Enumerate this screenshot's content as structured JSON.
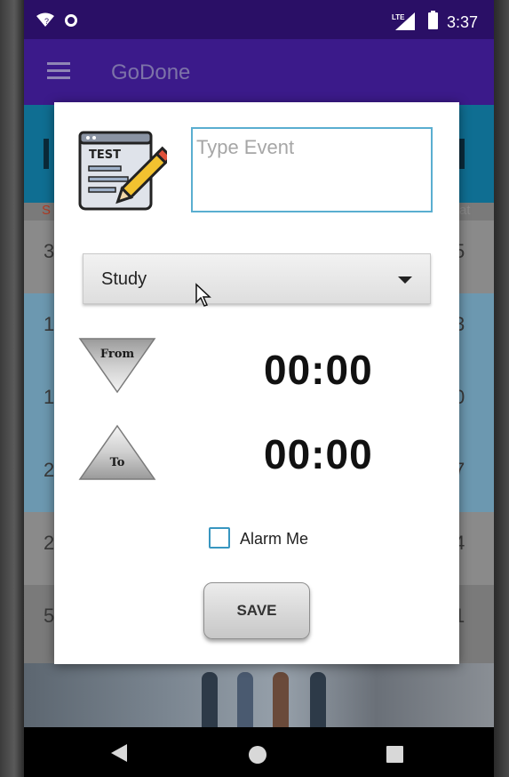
{
  "status_bar": {
    "time": "3:37",
    "network": "LTE"
  },
  "app_bar": {
    "title": "GoDone"
  },
  "calendar_background": {
    "weekday_left": "S",
    "weekday_right": "at",
    "rows": [
      {
        "left": "3",
        "right": "5"
      },
      {
        "left": "1",
        "right": "3"
      },
      {
        "left": "1",
        "right": "0"
      },
      {
        "left": "2",
        "right": "7"
      },
      {
        "left": "2",
        "right": "4"
      },
      {
        "left": "5",
        "right": "1"
      }
    ]
  },
  "dialog": {
    "icon_text": "TEST",
    "event_input": {
      "placeholder": "Type Event",
      "value": ""
    },
    "category": {
      "selected": "Study"
    },
    "from": {
      "label": "From",
      "time": "00:00"
    },
    "to": {
      "label": "To",
      "time": "00:00"
    },
    "alarm": {
      "label": "Alarm Me",
      "checked": false
    },
    "save_label": "SAVE"
  },
  "colors": {
    "status_bar": "#2a0f66",
    "app_bar": "#3b1a8a",
    "input_border": "#5aaed0",
    "checkbox_border": "#3896c0"
  }
}
